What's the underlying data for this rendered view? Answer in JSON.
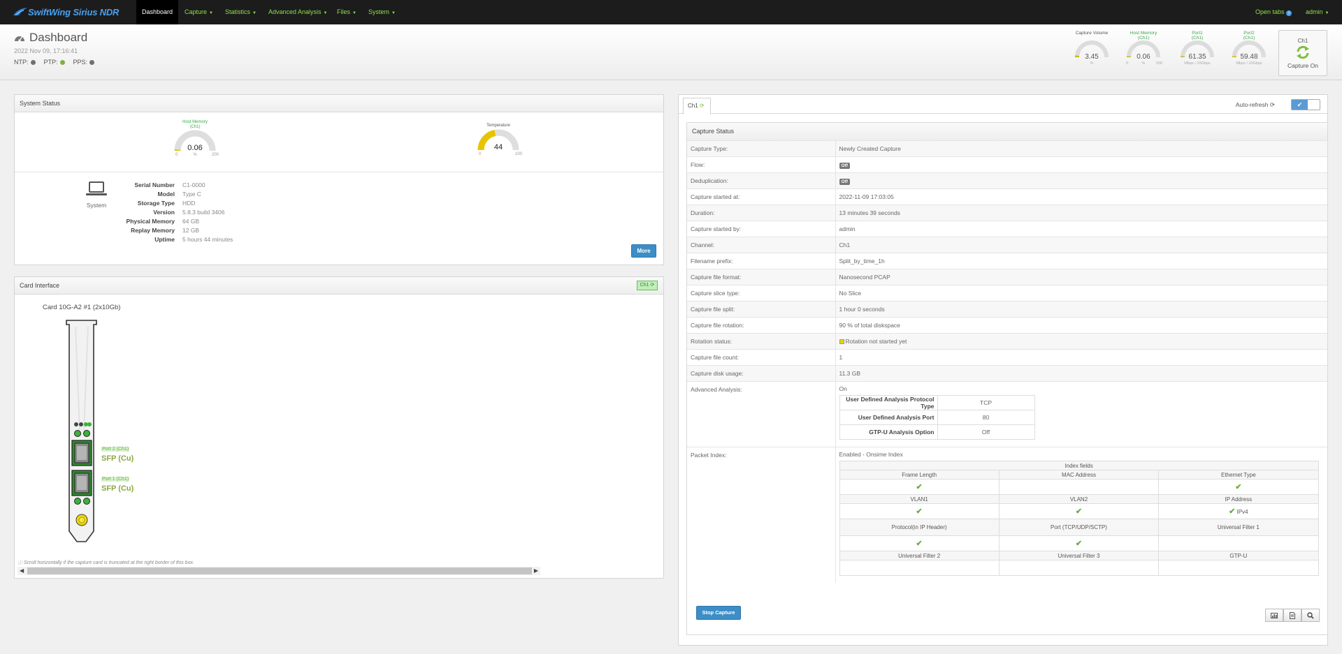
{
  "brand": "SwiftWing Sirius NDR",
  "nav": {
    "items": [
      "Dashboard",
      "Capture",
      "Statistics",
      "Advanced Analysis",
      "Files",
      "System"
    ],
    "open_tabs": "Open tabs",
    "user": "admin"
  },
  "header": {
    "title": "Dashboard",
    "datetime": "2022 Nov 09, 17:16:41",
    "sync": [
      {
        "label": "NTP:",
        "color": "#6c7178"
      },
      {
        "label": "PTP:",
        "color": "#7fb04a"
      },
      {
        "label": "PPS:",
        "color": "#6c7178"
      }
    ],
    "gauges": [
      {
        "label1": "Capture Volume",
        "label2": "",
        "value": "3.45",
        "unit": "%",
        "min": "",
        "max": "",
        "fraction": 0.035,
        "green": false
      },
      {
        "label1": "Host Memory",
        "label2": "(Ch1)",
        "value": "0.06",
        "unit": "%",
        "min": "0",
        "max": "200",
        "fraction": 0.0003,
        "green": true
      },
      {
        "label1": "Port1",
        "label2": "(Ch1)",
        "value": "61.35",
        "unit": "Mbps / 10Gbps",
        "min": "",
        "max": "",
        "fraction": 0.006,
        "green": true
      },
      {
        "label1": "Port2",
        "label2": "(Ch1)",
        "value": "59.48",
        "unit": "Mbps / 10Gbps",
        "min": "",
        "max": "",
        "fraction": 0.006,
        "green": true
      }
    ],
    "capture": {
      "channel": "Ch1",
      "status": "Capture On"
    }
  },
  "system_status": {
    "title": "System Status",
    "host_memory": {
      "label1": "Host Memory",
      "label2": "(Ch1)",
      "value": "0.06",
      "min": "0",
      "unit": "%",
      "max": "200",
      "fraction": 0.0003
    },
    "temperature": {
      "label": "Temperature",
      "value": "44",
      "min": "0",
      "max": "100",
      "fraction": 0.44
    },
    "system_label": "System",
    "info": [
      {
        "k": "Serial Number",
        "v": "C1-0000"
      },
      {
        "k": "Model",
        "v": "Type C"
      },
      {
        "k": "Storage Type",
        "v": "HDD"
      },
      {
        "k": "Version",
        "v": "5.8.3 build 3406"
      },
      {
        "k": "Physical Memory",
        "v": "64 GB"
      },
      {
        "k": "Replay Memory",
        "v": "12 GB"
      },
      {
        "k": "Uptime",
        "v": "5 hours 44 minutes"
      }
    ],
    "more_button": "More"
  },
  "card_interface": {
    "title": "Card Interface",
    "badge": "Ch1",
    "card_name": "Card 10G-A2 #1 (2x10Gb)",
    "port2_small": "Port 2 (Ch1)",
    "port2_big": "SFP (Cu)",
    "port1_small": "Port 1 (Ch1)",
    "port1_big": "SFP (Cu)",
    "note": "Scroll horizontally if the capture card is truncated at the right border of this box."
  },
  "channel_panel": {
    "tab": "Ch1",
    "auto_refresh": "Auto-refresh",
    "capture_status_title": "Capture Status",
    "rows": [
      {
        "k": "Capture Type:",
        "v": "Newly Created Capture"
      },
      {
        "k": "Flow:",
        "v": "Off"
      },
      {
        "k": "Deduplication:",
        "v": "Off"
      },
      {
        "k": "Capture started at:",
        "v": "2022-11-09 17:03:05"
      },
      {
        "k": "Duration:",
        "v": "13 minutes 39 seconds"
      },
      {
        "k": "Capture started by:",
        "v": "admin"
      },
      {
        "k": "Channel:",
        "v": "Ch1"
      },
      {
        "k": "Filename prefix:",
        "v": "Split_by_time_1h"
      },
      {
        "k": "Capture file format:",
        "v": "Nanosecond PCAP"
      },
      {
        "k": "Capture slice type:",
        "v": "No Slice"
      },
      {
        "k": "Capture file split:",
        "v": "1 hour 0 seconds"
      },
      {
        "k": "Capture file rotation:",
        "v": "90 % of total diskspace"
      },
      {
        "k": "Rotation status:",
        "v": "Rotation not started yet"
      },
      {
        "k": "Capture file count:",
        "v": "1"
      },
      {
        "k": "Capture disk usage:",
        "v": "11.3 GB"
      }
    ],
    "advanced": {
      "k": "Advanced Analysis:",
      "v": "On",
      "rows": [
        {
          "k": "User Defined Analysis Protocol Type",
          "v": "TCP"
        },
        {
          "k": "User Defined Analysis Port",
          "v": "80"
        },
        {
          "k": "GTP-U Analysis Option",
          "v": "Off"
        }
      ]
    },
    "packet_index": {
      "k": "Packet Index:",
      "v": "Enabled - Onsime Index",
      "header": "Index fields",
      "groups": [
        {
          "labels": [
            "Frame Length",
            "MAC Address",
            "Ethernet Type"
          ],
          "checks": [
            true,
            false,
            true
          ],
          "extra": [
            "",
            "",
            ""
          ]
        },
        {
          "labels": [
            "VLAN1",
            "VLAN2",
            "IP Address"
          ],
          "checks": [
            true,
            true,
            true
          ],
          "extra": [
            "",
            "",
            "IPv4"
          ]
        },
        {
          "labels": [
            "Protocol(in IP Header)",
            "Port (TCP/UDP/SCTP)",
            "Universal Filter 1"
          ],
          "checks": [
            true,
            true,
            false
          ],
          "extra": [
            "",
            "",
            ""
          ]
        },
        {
          "labels": [
            "Universal Filter 2",
            "Universal Filter 3",
            "GTP-U"
          ],
          "checks": [
            false,
            false,
            false
          ],
          "extra": [
            "",
            "",
            ""
          ]
        }
      ]
    },
    "stop_button": "Stop Capture"
  }
}
